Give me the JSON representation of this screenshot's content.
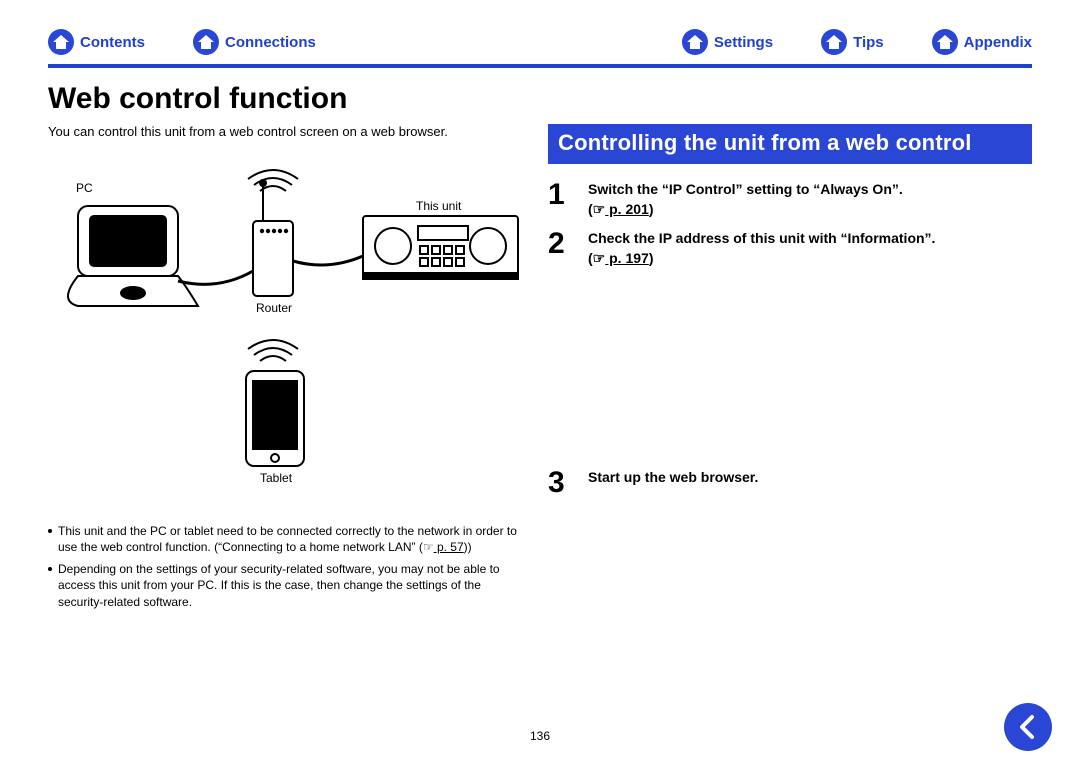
{
  "nav": {
    "contents": "Contents",
    "connections": "Connections",
    "settings": "Settings",
    "tips": "Tips",
    "appendix": "Appendix"
  },
  "title": "Web control function",
  "intro": "You can control this unit from a web control screen on a web browser.",
  "diagram": {
    "pc": "PC",
    "router": "Router",
    "this_unit": "This unit",
    "tablet": "Tablet"
  },
  "notes": {
    "n1a": "This unit and the PC or tablet need to be connected correctly to the network in order to use the web control function. (“Connecting to a home network LAN” (",
    "n1_link_prefix": "☞",
    "n1_link": " p. 57",
    "n1b": "))",
    "n2": "Depending on the settings of your security-related software, you may not be able to access this unit from your PC. If this is the case, then change the settings of the security-related software."
  },
  "section_header": "Controlling the unit from a web control",
  "steps": {
    "s1": {
      "num": "1",
      "text": "Switch the “IP Control” setting to “Always On”.",
      "ref_prefix": "(☞",
      "ref": " p. 201",
      "ref_suffix": ")"
    },
    "s2": {
      "num": "2",
      "text": "Check the IP address of this unit with “Information”.",
      "ref_prefix": "(☞",
      "ref": " p. 197",
      "ref_suffix": ")"
    },
    "s3": {
      "num": "3",
      "text": "Start up the web browser."
    }
  },
  "page_number": "136"
}
